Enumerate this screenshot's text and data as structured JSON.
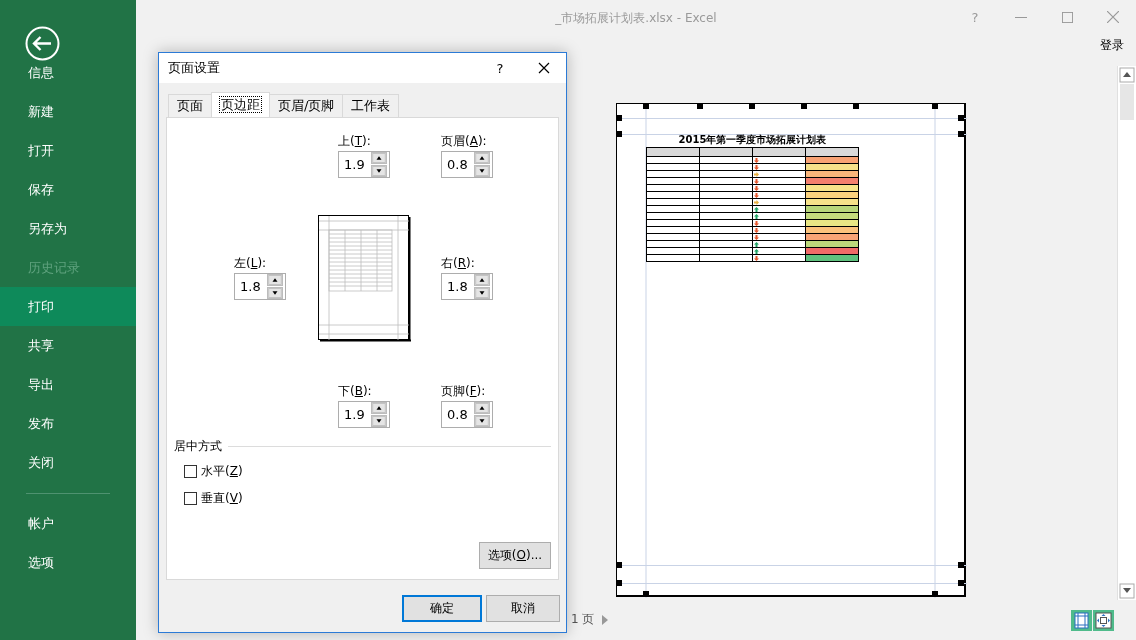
{
  "window": {
    "title": "_市场拓展计划表.xlsx - Excel",
    "help": "?",
    "sign_in": "登录"
  },
  "sidebar": {
    "items": [
      {
        "label": "信息",
        "selected": false,
        "disabled": false
      },
      {
        "label": "新建",
        "selected": false,
        "disabled": false
      },
      {
        "label": "打开",
        "selected": false,
        "disabled": false
      },
      {
        "label": "保存",
        "selected": false,
        "disabled": false
      },
      {
        "label": "另存为",
        "selected": false,
        "disabled": false
      },
      {
        "label": "历史记录",
        "selected": false,
        "disabled": true
      },
      {
        "label": "打印",
        "selected": true,
        "disabled": false
      },
      {
        "label": "共享",
        "selected": false,
        "disabled": false
      },
      {
        "label": "导出",
        "selected": false,
        "disabled": false
      },
      {
        "label": "发布",
        "selected": false,
        "disabled": false
      },
      {
        "label": "关闭",
        "selected": false,
        "disabled": false
      }
    ],
    "bottom_items": [
      {
        "label": "帐户",
        "selected": false,
        "disabled": false
      },
      {
        "label": "选项",
        "selected": false,
        "disabled": false
      }
    ]
  },
  "dialog": {
    "title": "页面设置",
    "help": "?",
    "tabs": [
      {
        "label": "页面",
        "selected": false
      },
      {
        "label": "页边距",
        "selected": true
      },
      {
        "label": "页眉/页脚",
        "selected": false
      },
      {
        "label": "工作表",
        "selected": false
      }
    ],
    "margins": {
      "top": {
        "label": "上(T):",
        "value": "1.9"
      },
      "header": {
        "label": "页眉(A):",
        "value": "0.8"
      },
      "left": {
        "label": "左(L):",
        "value": "1.8"
      },
      "right": {
        "label": "右(R):",
        "value": "1.8"
      },
      "bottom": {
        "label": "下(B):",
        "value": "1.9"
      },
      "footer": {
        "label": "页脚(F):",
        "value": "0.8"
      }
    },
    "centering": {
      "title": "居中方式",
      "options": [
        {
          "label": "水平(Z)",
          "checked": false
        },
        {
          "label": "垂直(V)",
          "checked": false
        }
      ]
    },
    "options_button": "选项(O)...",
    "buttons": [
      {
        "label": "确定",
        "default": true
      },
      {
        "label": "取消",
        "default": false
      }
    ]
  },
  "preview": {
    "sheet_title": "2015年第一季度市场拓展计划表",
    "rows": [
      {
        "kind": "down",
        "color": "#f8a274"
      },
      {
        "kind": "down",
        "color": "#f6e08a"
      },
      {
        "kind": "right",
        "color": "#f9b57a"
      },
      {
        "kind": "down",
        "color": "#f4806e"
      },
      {
        "kind": "down",
        "color": "#f8e48a"
      },
      {
        "kind": "down",
        "color": "#fbd27e"
      },
      {
        "kind": "right",
        "color": "#f7e28a"
      },
      {
        "kind": "up",
        "color": "#b8d67a"
      },
      {
        "kind": "up",
        "color": "#c4da7c"
      },
      {
        "kind": "down",
        "color": "#e9e684"
      },
      {
        "kind": "down",
        "color": "#fcc27c"
      },
      {
        "kind": "down",
        "color": "#f9a476"
      },
      {
        "kind": "up",
        "color": "#bcd87b"
      },
      {
        "kind": "up",
        "color": "#f06a68"
      },
      {
        "kind": "down",
        "color": "#5ec17e"
      }
    ],
    "page_indicator": "1 页"
  }
}
